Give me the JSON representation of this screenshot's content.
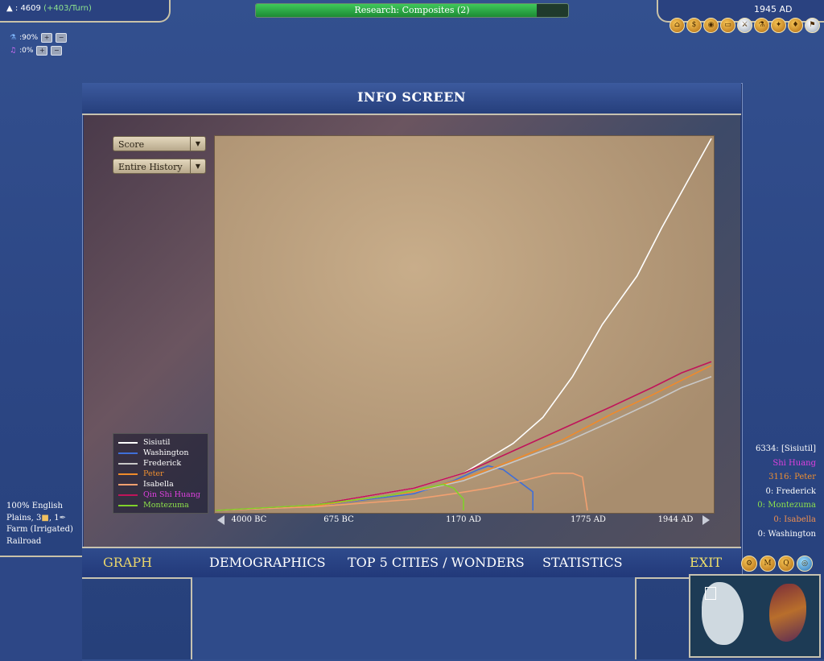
{
  "hud": {
    "gold": "4609",
    "gold_delta": "(+403/Turn)",
    "science_pct": ":90%",
    "culture_pct": ":0%",
    "research_label": "Research: Composites (2)",
    "research_progress": 0.9,
    "date": "1945 AD"
  },
  "window": {
    "title": "INFO SCREEN",
    "dropdown_metric": "Score",
    "dropdown_range": "Entire History"
  },
  "tabs": {
    "graph": "GRAPH",
    "demographics": "DEMOGRAPHICS",
    "top5": "TOP 5 CITIES / WONDERS",
    "statistics": "STATISTICS",
    "exit": "EXIT"
  },
  "chart_data": {
    "type": "line",
    "x_ticks": [
      "4000 BC",
      "675 BC",
      "1170 AD",
      "1775 AD",
      "1944 AD"
    ],
    "xlim": [
      "4000 BC",
      "1944 AD"
    ],
    "grid": false,
    "legend_position": "bottom-left",
    "series": [
      {
        "name": "Sisiutil",
        "color": "#ffffff",
        "x": [
          0,
          0.2,
          0.4,
          0.5,
          0.6,
          0.66,
          0.72,
          0.78,
          0.85,
          0.9,
          0.95,
          1.0
        ],
        "y": [
          0,
          0.015,
          0.06,
          0.1,
          0.18,
          0.25,
          0.36,
          0.5,
          0.63,
          0.76,
          0.88,
          1.0
        ]
      },
      {
        "name": "Washington",
        "color": "#3f6fd8",
        "x": [
          0,
          0.2,
          0.4,
          0.48,
          0.53,
          0.55,
          0.58,
          0.6,
          0.62,
          0.64,
          0.64
        ],
        "y": [
          0,
          0.012,
          0.045,
          0.08,
          0.11,
          0.12,
          0.11,
          0.09,
          0.07,
          0.05,
          0.0
        ]
      },
      {
        "name": "Frederick",
        "color": "#c8c8c8",
        "x": [
          0,
          0.2,
          0.4,
          0.5,
          0.6,
          0.7,
          0.8,
          0.88,
          0.94,
          1.0
        ],
        "y": [
          0,
          0.012,
          0.05,
          0.08,
          0.13,
          0.18,
          0.24,
          0.29,
          0.33,
          0.36
        ]
      },
      {
        "name": "Peter",
        "color": "#f08a2a",
        "x": [
          0,
          0.2,
          0.4,
          0.5,
          0.6,
          0.7,
          0.8,
          0.88,
          0.94,
          1.0
        ],
        "y": [
          0,
          0.012,
          0.05,
          0.085,
          0.135,
          0.19,
          0.26,
          0.31,
          0.35,
          0.39
        ]
      },
      {
        "name": "Isabella",
        "color": "#f2a070",
        "x": [
          0,
          0.2,
          0.4,
          0.48,
          0.55,
          0.62,
          0.68,
          0.72,
          0.74,
          0.75
        ],
        "y": [
          0,
          0.01,
          0.03,
          0.045,
          0.06,
          0.08,
          0.1,
          0.1,
          0.09,
          0.0
        ]
      },
      {
        "name": "Qin Shi Huang",
        "color": "#c0145a",
        "x": [
          0,
          0.2,
          0.4,
          0.5,
          0.6,
          0.7,
          0.8,
          0.88,
          0.94,
          1.0
        ],
        "y": [
          0,
          0.015,
          0.06,
          0.1,
          0.16,
          0.22,
          0.28,
          0.33,
          0.37,
          0.4
        ]
      },
      {
        "name": "Montezuma",
        "color": "#7fd12a",
        "x": [
          0,
          0.2,
          0.35,
          0.42,
          0.46,
          0.48,
          0.5,
          0.5
        ],
        "y": [
          0,
          0.015,
          0.04,
          0.06,
          0.07,
          0.06,
          0.03,
          0.0
        ]
      }
    ]
  },
  "scores": [
    {
      "text": "6334: [Sisiutil]",
      "color": "#ffffff"
    },
    {
      "text": "Shi Huang",
      "color": "#e040e0"
    },
    {
      "text": "3116: Peter",
      "color": "#f09030"
    },
    {
      "text": "0: Frederick",
      "color": "#ffffff"
    },
    {
      "text": "0: Montezuma",
      "color": "#8ee34a"
    },
    {
      "text": "0: Isabella",
      "color": "#f09050"
    },
    {
      "text": "0: Washington",
      "color": "#ffffff"
    }
  ],
  "tile_info": {
    "culture": "100% English",
    "plains": "Plains, 3",
    "plains_extra": ", 1",
    "improvement": "Farm (Irrigated)",
    "route": "Railroad"
  }
}
